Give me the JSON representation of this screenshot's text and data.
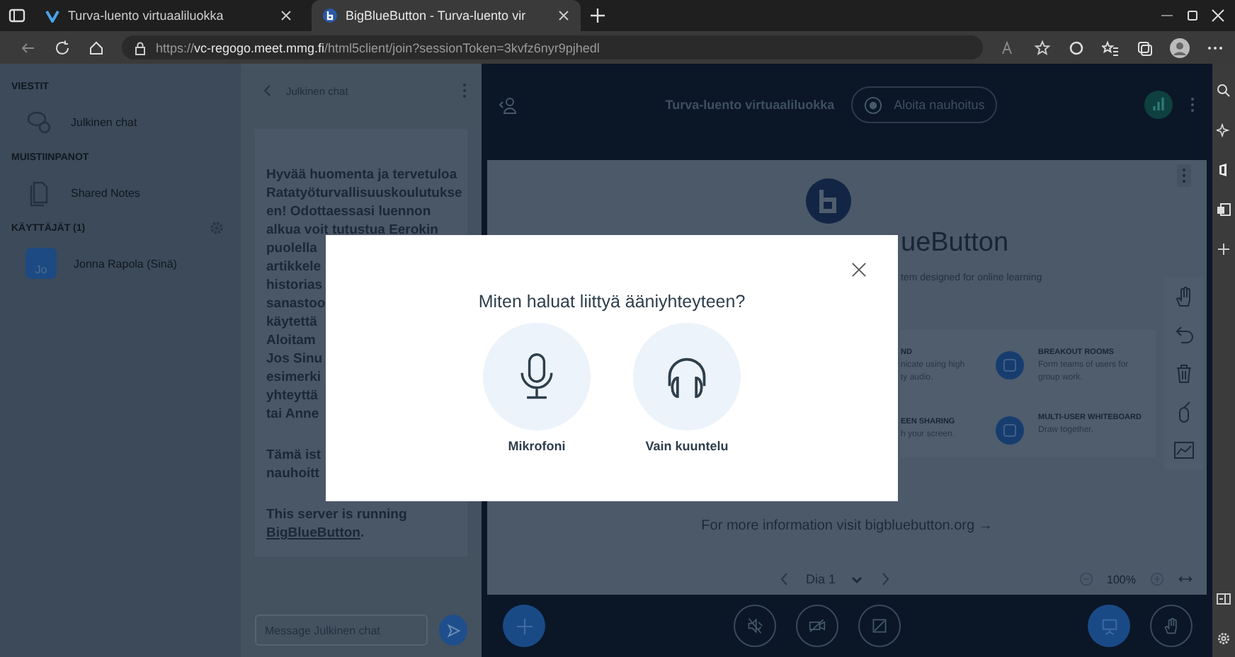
{
  "browser": {
    "tabs": [
      {
        "title": "Turva-luento virtuaaliluokka",
        "selected": false
      },
      {
        "title": "BigBlueButton - Turva-luento vir",
        "selected": true
      }
    ],
    "url": "https://**vc-regogo.meet.mmg.fi**/html5client/join?sessionToken=3kvfz6nyr9pjhedl"
  },
  "sidebar": {
    "sections": [
      {
        "kind": "messages",
        "heading": "VIESTIT",
        "items": [
          {
            "kind": "chat",
            "label": "Julkinen chat"
          }
        ]
      },
      {
        "kind": "notes",
        "heading": "MUISTIINPANOT",
        "items": [
          {
            "kind": "notes",
            "label": "Shared Notes"
          }
        ]
      },
      {
        "kind": "users",
        "heading": "KÄYTTÄJÄT (1)",
        "items": [
          {
            "kind": "user",
            "initials": "Jo",
            "label": "Jonna Rapola (Sinä)"
          }
        ]
      }
    ]
  },
  "chat": {
    "title": "Julkinen chat",
    "paragraphs": [
      {
        "lines": [
          "Hyvää huomenta ja tervetuloa",
          "Ratatyöturvallisuuskoulutukse",
          "en! Odottaessasi luennon",
          "alkua voit tutustua Eerokin",
          "puolella",
          "artikkele",
          "historias",
          "sanastoo",
          "käytettä",
          "Aloitam",
          "Jos Sinu",
          "esimerki",
          "yhteyttä",
          "tai Anne"
        ]
      },
      {
        "lines": [
          "Tämä ist",
          "nauhoitt"
        ]
      },
      {
        "lines": [
          "This server is running"
        ],
        "link": "BigBlueButton",
        "after": "."
      }
    ],
    "placeholder": "Message Julkinen chat"
  },
  "meeting": {
    "title": "Turva-luento virtuaaliluokka",
    "record_label": "Aloita nauhoitus",
    "slide": {
      "title": "ueButton",
      "subtitle": "tem designed for online learning",
      "left_features": [
        {
          "heading": "ND",
          "lines": [
            "nicate using high",
            "ty audio."
          ]
        },
        {
          "heading": "EEN SHARING",
          "lines": [
            "h your screen."
          ]
        }
      ],
      "right_features": [
        {
          "heading": "BREAKOUT ROOMS",
          "lines": [
            "Form teams of users for",
            "group work."
          ]
        },
        {
          "heading": "MULTI-USER WHITEBOARD",
          "lines": [
            "Draw together."
          ]
        }
      ],
      "footer": "For more information visit bigbluebutton.org →"
    },
    "slide_label": "Dia 1",
    "zoom": "100%"
  },
  "dialog": {
    "title": "Miten haluat liittyä ääniyhteyteen?",
    "options": [
      {
        "kind": "microphone",
        "label": "Mikrofoni"
      },
      {
        "kind": "listen",
        "label": "Vain kuuntelu"
      }
    ]
  }
}
